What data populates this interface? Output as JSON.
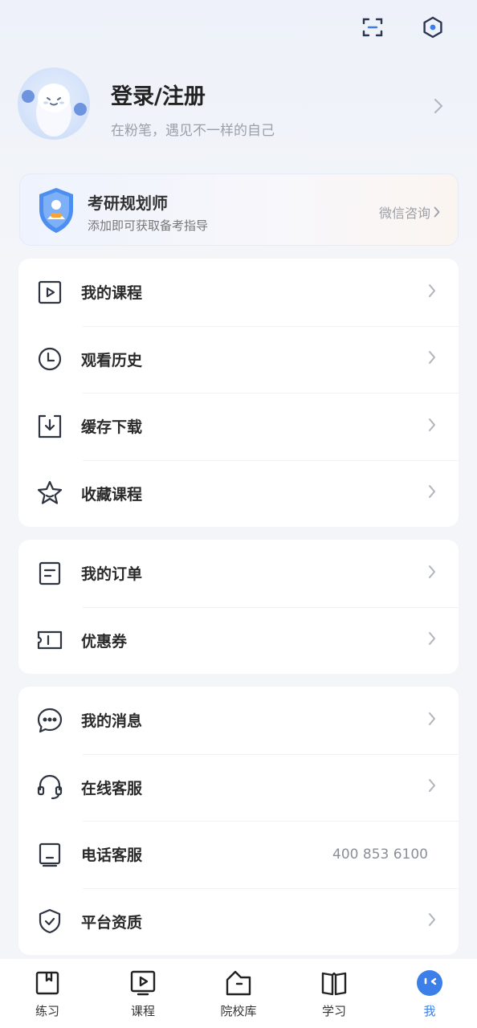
{
  "header": {
    "scan_icon": "scan-icon",
    "settings_icon": "settings-hexagon-icon"
  },
  "profile": {
    "title": "登录/注册",
    "subtitle": "在粉笔，遇见不一样的自己"
  },
  "planner": {
    "title": "考研规划师",
    "subtitle": "添加即可获取备考指导",
    "action": "微信咨询"
  },
  "group1": [
    {
      "label": "我的课程",
      "icon": "play-course-icon"
    },
    {
      "label": "观看历史",
      "icon": "clock-icon"
    },
    {
      "label": "缓存下载",
      "icon": "download-icon"
    },
    {
      "label": "收藏课程",
      "icon": "star-icon"
    }
  ],
  "group2": [
    {
      "label": "我的订单",
      "icon": "order-icon"
    },
    {
      "label": "优惠券",
      "icon": "coupon-icon"
    }
  ],
  "group3": [
    {
      "label": "我的消息",
      "icon": "message-icon"
    },
    {
      "label": "在线客服",
      "icon": "headset-icon"
    },
    {
      "label": "电话客服",
      "icon": "phone-icon",
      "value": "400 853 6100"
    },
    {
      "label": "平台资质",
      "icon": "shield-check-icon"
    }
  ],
  "tabs": [
    {
      "label": "练习",
      "icon": "bookmark-icon"
    },
    {
      "label": "课程",
      "icon": "play-icon"
    },
    {
      "label": "院校库",
      "icon": "school-icon"
    },
    {
      "label": "学习",
      "icon": "book-icon"
    },
    {
      "label": "我",
      "icon": "me-icon",
      "active": true
    }
  ],
  "colors": {
    "accent": "#3d7fe8",
    "background": "#f3f5f9",
    "card": "#ffffff"
  }
}
